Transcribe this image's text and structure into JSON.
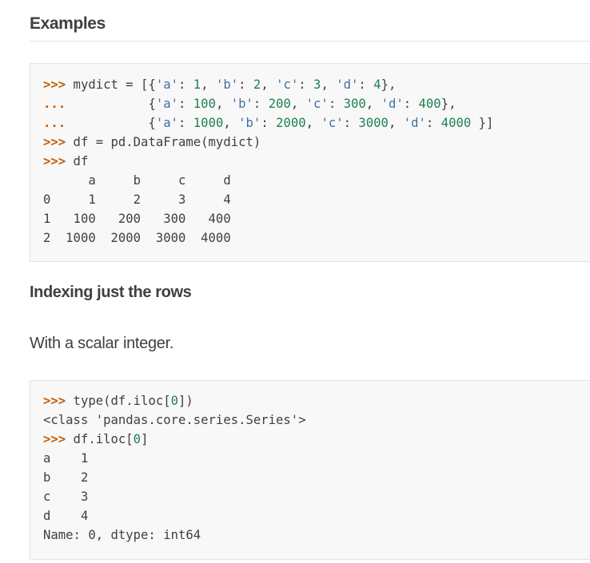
{
  "section_heading": "Examples",
  "subsection_heading": "Indexing just the rows",
  "paragraph": "With a scalar integer.",
  "code_block_1": {
    "prompt": ">>>",
    "continuation": "...",
    "lines": [
      ">>> mydict = [{'a': 1, 'b': 2, 'c': 3, 'd': 4},",
      "...           {'a': 100, 'b': 200, 'c': 300, 'd': 400},",
      "...           {'a': 1000, 'b': 2000, 'c': 3000, 'd': 4000 }]",
      ">>> df = pd.DataFrame(mydict)",
      ">>> df",
      "      a     b     c     d",
      "0     1     2     3     4",
      "1   100   200   300   400",
      "2  1000  2000  3000  4000"
    ]
  },
  "code_block_2": {
    "lines": [
      ">>> type(df.iloc[0])",
      "<class 'pandas.core.series.Series'>",
      ">>> df.iloc[0]",
      "a    1",
      "b    2",
      "c    3",
      "d    4",
      "Name: 0, dtype: int64"
    ]
  }
}
